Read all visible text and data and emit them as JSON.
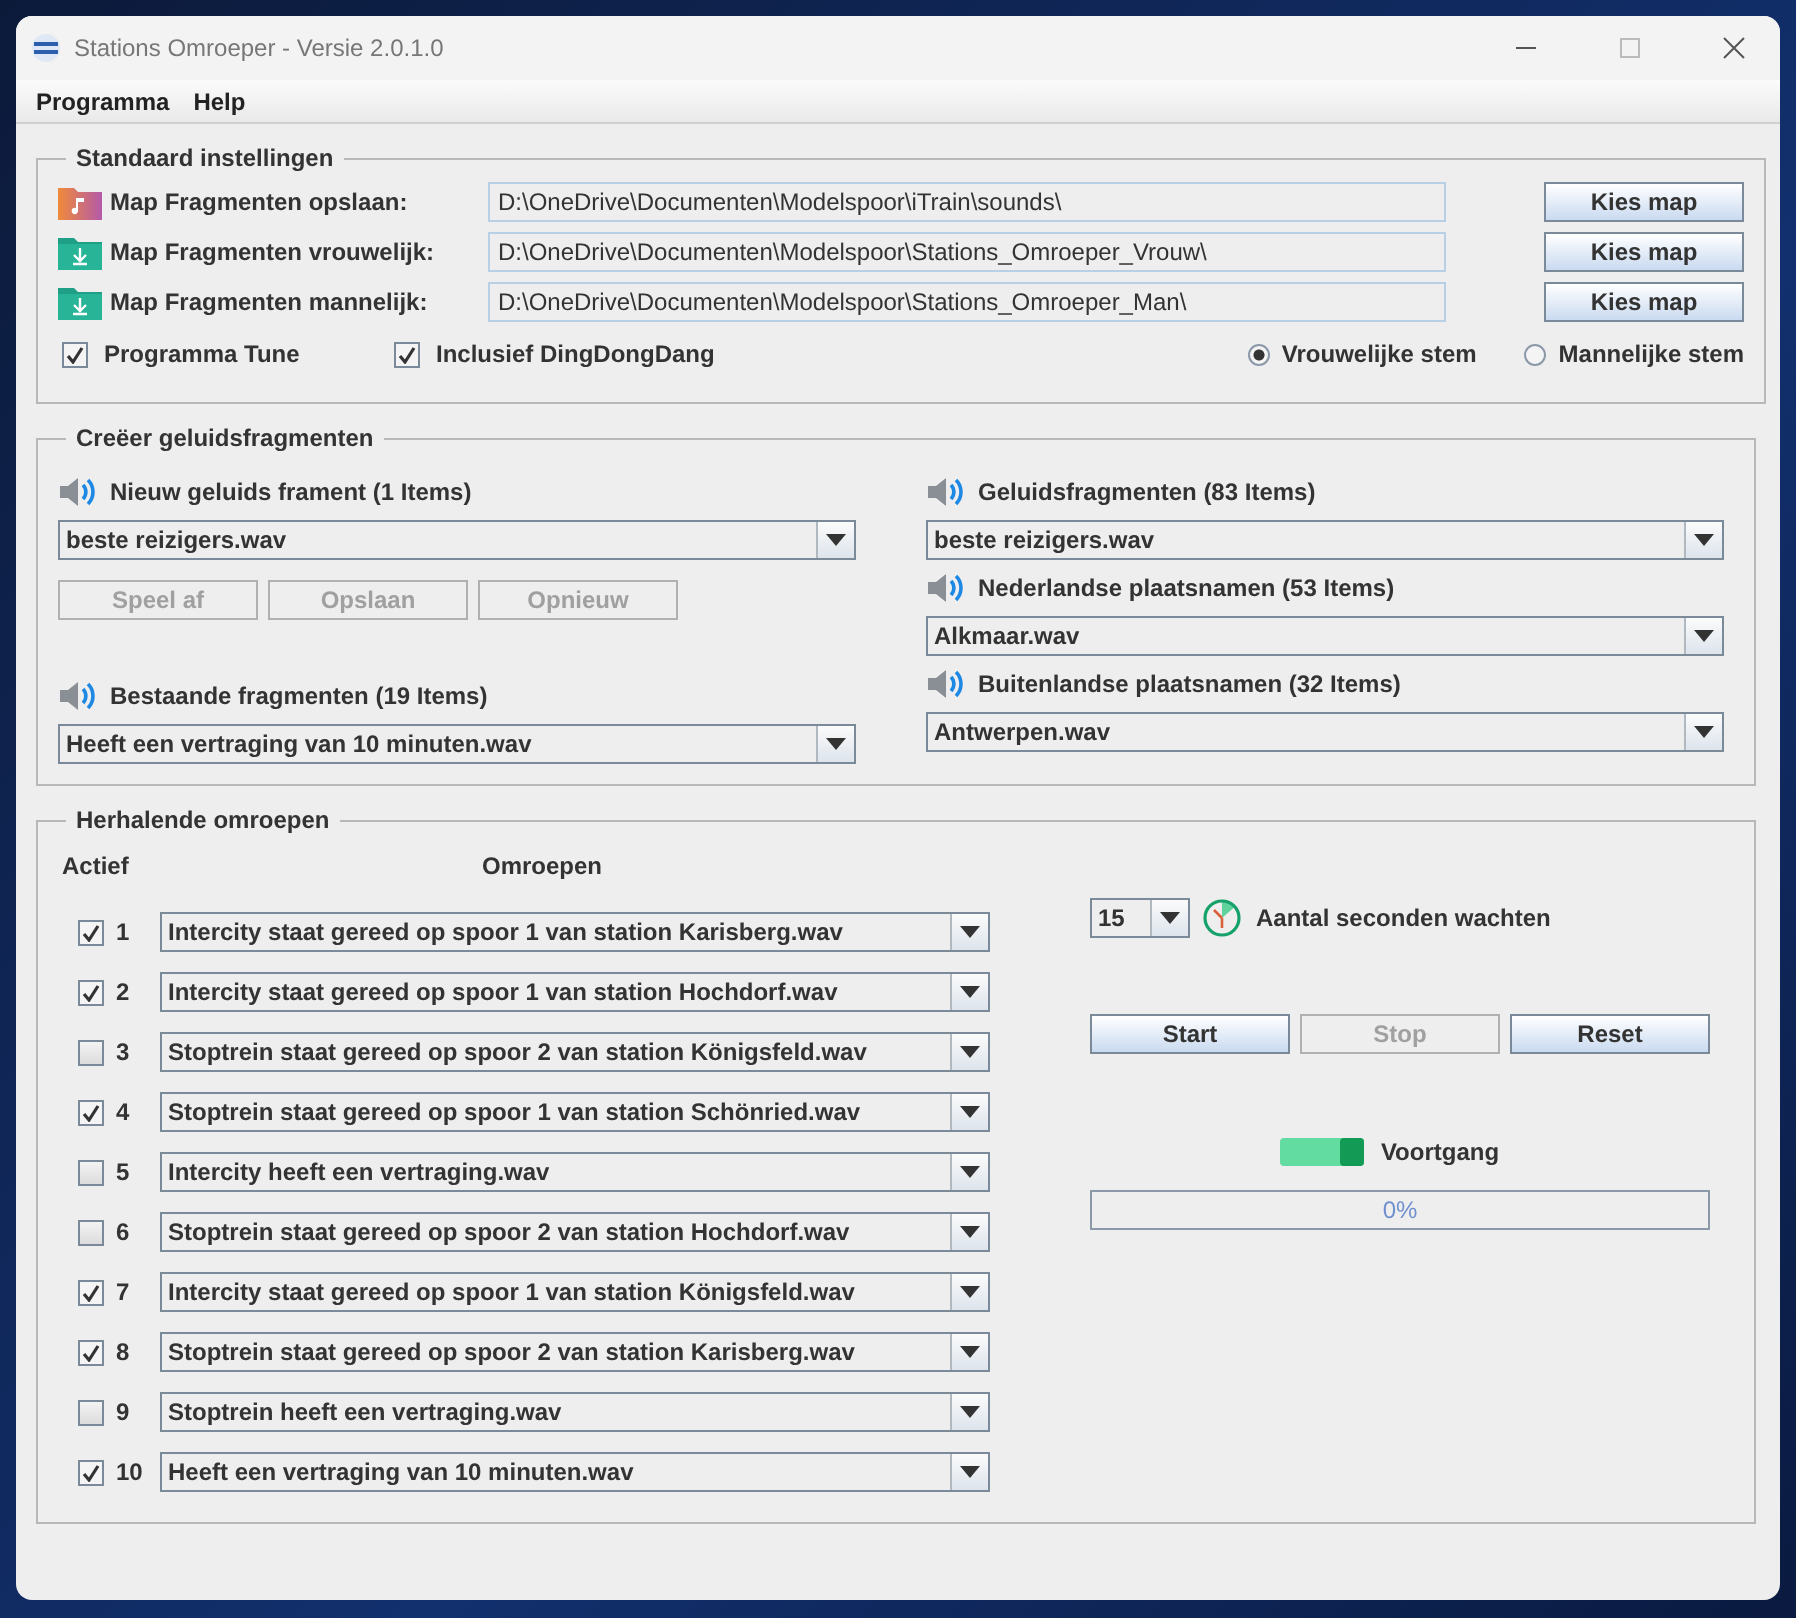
{
  "window": {
    "title": "Stations Omroeper - Versie 2.0.1.0"
  },
  "menu": [
    "Programma",
    "Help"
  ],
  "settings": {
    "title": "Standaard instellingen",
    "folders": [
      {
        "kind": "music",
        "label": "Map Fragmenten opslaan:",
        "path": "D:\\OneDrive\\Documenten\\Modelspoor\\iTrain\\sounds\\",
        "button": "Kies map"
      },
      {
        "kind": "download",
        "label": "Map Fragmenten vrouwelijk:",
        "path": "D:\\OneDrive\\Documenten\\Modelspoor\\Stations_Omroeper_Vrouw\\",
        "button": "Kies map"
      },
      {
        "kind": "download",
        "label": "Map Fragmenten mannelijk:",
        "path": "D:\\OneDrive\\Documenten\\Modelspoor\\Stations_Omroeper_Man\\",
        "button": "Kies map"
      }
    ],
    "checkboxes": [
      {
        "label": "Programma Tune",
        "checked": true
      },
      {
        "label": "Inclusief DingDongDang",
        "checked": true
      }
    ],
    "voices": [
      {
        "label": "Vrouwelijke stem",
        "selected": true
      },
      {
        "label": "Mannelijke stem",
        "selected": false
      }
    ]
  },
  "create": {
    "title": "Creëer geluidsfragmenten",
    "new_fragment": {
      "label": "Nieuw geluids frament (1 Items)",
      "value": "beste reizigers.wav"
    },
    "buttons": [
      {
        "label": "Speel af",
        "disabled": true
      },
      {
        "label": "Opslaan",
        "disabled": true
      },
      {
        "label": "Opnieuw",
        "disabled": true
      }
    ],
    "existing": {
      "label": "Bestaande fragmenten (19 Items)",
      "value": "Heeft een vertraging van 10 minuten.wav"
    },
    "lists": [
      {
        "label": "Geluidsfragmenten (83 Items)",
        "value": "beste reizigers.wav"
      },
      {
        "label": "Nederlandse plaatsnamen (53 Items)",
        "value": "Alkmaar.wav"
      },
      {
        "label": "Buitenlandse plaatsnamen (32 Items)",
        "value": "Antwerpen.wav"
      }
    ]
  },
  "repeat": {
    "title": "Herhalende omroepen",
    "columns": [
      "Actief",
      "Omroepen"
    ],
    "rows": [
      {
        "number": "1",
        "checked": true,
        "value": "Intercity staat gereed op spoor 1 van station Karisberg.wav"
      },
      {
        "number": "2",
        "checked": true,
        "value": "Intercity staat gereed op spoor 1 van station Hochdorf.wav"
      },
      {
        "number": "3",
        "checked": false,
        "value": "Stoptrein staat gereed op spoor 2 van station Königsfeld.wav"
      },
      {
        "number": "4",
        "checked": true,
        "value": "Stoptrein staat gereed op spoor 1 van station Schönried.wav"
      },
      {
        "number": "5",
        "checked": false,
        "value": "Intercity heeft een vertraging.wav"
      },
      {
        "number": "6",
        "checked": false,
        "value": "Stoptrein staat gereed op spoor 2 van station Hochdorf.wav"
      },
      {
        "number": "7",
        "checked": true,
        "value": "Intercity staat gereed op spoor 1 van station Königsfeld.wav"
      },
      {
        "number": "8",
        "checked": true,
        "value": "Stoptrein staat gereed op spoor 2 van station Karisberg.wav"
      },
      {
        "number": "9",
        "checked": false,
        "value": "Stoptrein heeft een vertraging.wav"
      },
      {
        "number": "10",
        "checked": true,
        "value": "Heeft een vertraging van 10 minuten.wav"
      }
    ],
    "seconds": {
      "value": "15",
      "label": "Aantal seconden wachten"
    },
    "buttons": [
      {
        "label": "Start",
        "disabled": false
      },
      {
        "label": "Stop",
        "disabled": true
      },
      {
        "label": "Reset",
        "disabled": false
      }
    ],
    "progress": {
      "label": "Voortgang",
      "level": 0,
      "reading": "0%"
    }
  }
}
